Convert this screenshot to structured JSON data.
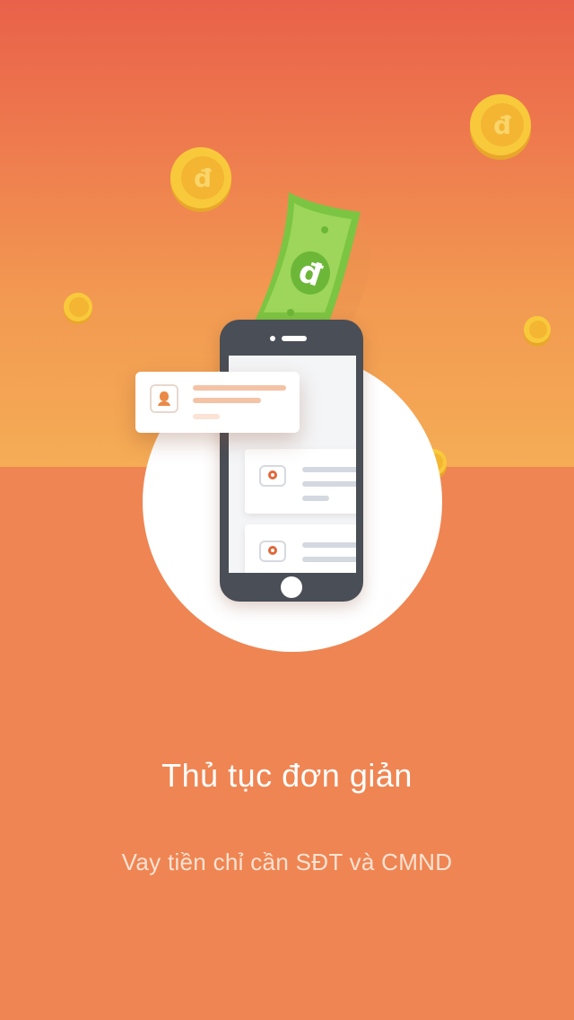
{
  "onboarding": {
    "title": "Thủ tục đơn giản",
    "subtitle": "Vay tiền chỉ cần SĐT và CMND"
  },
  "illustration": {
    "currency_symbol": "đ",
    "icons": {
      "coin": "dong-coin-icon",
      "bill": "dong-banknote-icon",
      "phone": "smartphone-icon",
      "user": "user-avatar-icon",
      "card": "loan-item-icon"
    }
  },
  "colors": {
    "background": "#EF8552",
    "gradient_top": "#E9614A",
    "gradient_bottom": "#F5AC55",
    "coin": "#F7BE34",
    "bill": "#8CCB4E",
    "phone": "#4A4E56",
    "text": "#FFFFFF"
  }
}
